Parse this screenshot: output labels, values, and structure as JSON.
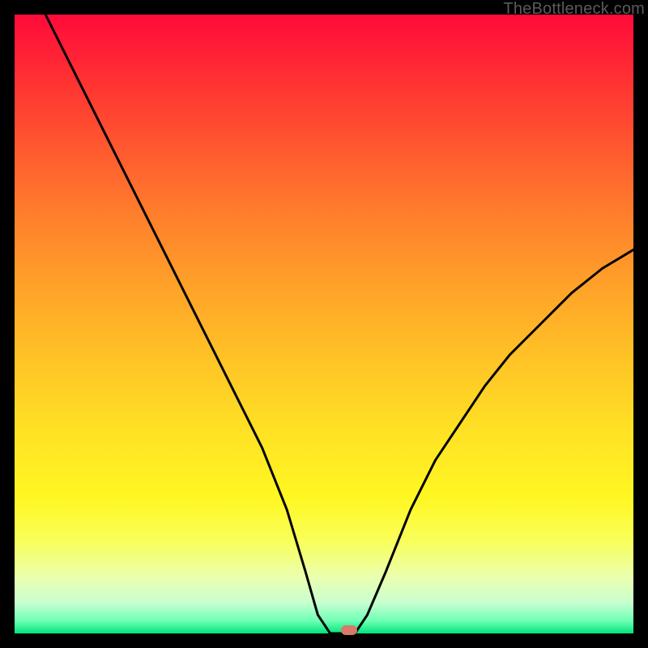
{
  "watermark": "TheBottleneck.com",
  "chart_data": {
    "type": "line",
    "title": "",
    "xlabel": "",
    "ylabel": "",
    "xlim": [
      0,
      100
    ],
    "ylim": [
      0,
      100
    ],
    "grid": false,
    "legend": false,
    "background_gradient": {
      "direction": "vertical",
      "stops": [
        {
          "pos": 0,
          "color": "#ff0a3a"
        },
        {
          "pos": 50,
          "color": "#ffc426"
        },
        {
          "pos": 85,
          "color": "#f9ff59"
        },
        {
          "pos": 100,
          "color": "#00e47a"
        }
      ]
    },
    "series": [
      {
        "name": "bottleneck-curve",
        "color": "#000000",
        "x": [
          5,
          10,
          15,
          20,
          25,
          28,
          32,
          36,
          40,
          44,
          47,
          49,
          51,
          53,
          55,
          57,
          60,
          64,
          68,
          72,
          76,
          80,
          85,
          90,
          95,
          100
        ],
        "y": [
          100,
          90,
          80,
          70,
          60,
          54,
          46,
          38,
          30,
          20,
          10,
          3,
          0,
          0,
          0,
          3,
          10,
          20,
          28,
          34,
          40,
          45,
          50,
          55,
          59,
          62
        ]
      }
    ],
    "markers": [
      {
        "name": "optimal-point",
        "x": 54,
        "y": 0,
        "color": "#d97a6b"
      }
    ]
  }
}
